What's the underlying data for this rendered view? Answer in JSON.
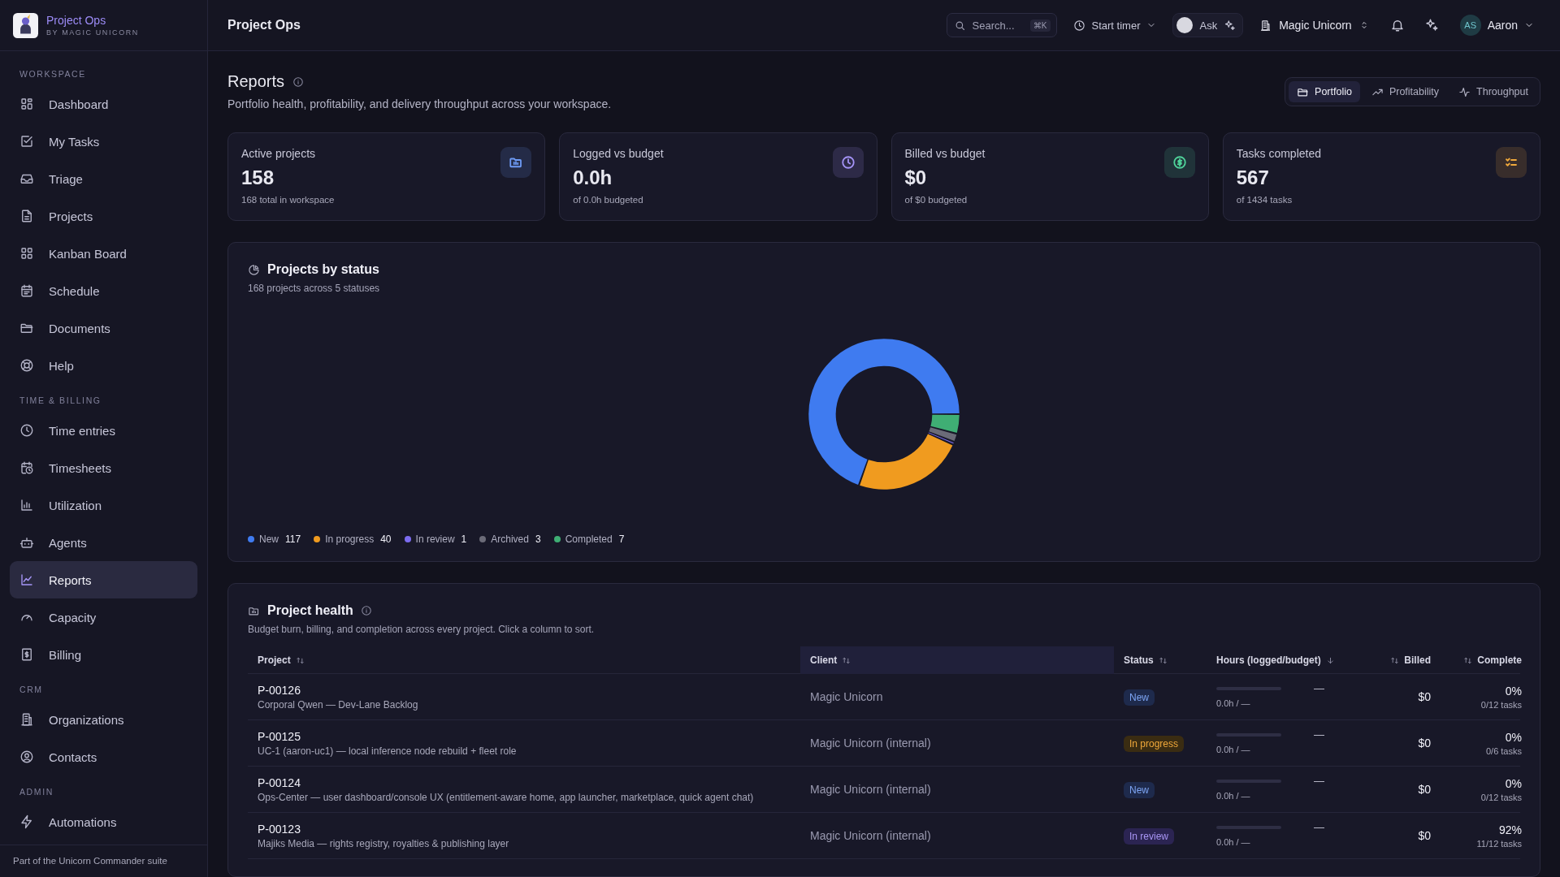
{
  "brand": {
    "name": "Project Ops",
    "tagline": "BY MAGIC UNICORN"
  },
  "sidebar": {
    "sections": [
      {
        "label": "WORKSPACE",
        "items": [
          {
            "label": "Dashboard",
            "selected": false
          },
          {
            "label": "My Tasks",
            "selected": false
          },
          {
            "label": "Triage",
            "selected": false
          },
          {
            "label": "Projects",
            "selected": false
          },
          {
            "label": "Kanban Board",
            "selected": false
          },
          {
            "label": "Schedule",
            "selected": false
          },
          {
            "label": "Documents",
            "selected": false
          },
          {
            "label": "Help",
            "selected": false
          }
        ]
      },
      {
        "label": "TIME & BILLING",
        "items": [
          {
            "label": "Time entries",
            "selected": false
          },
          {
            "label": "Timesheets",
            "selected": false
          },
          {
            "label": "Utilization",
            "selected": false
          },
          {
            "label": "Agents",
            "selected": false
          },
          {
            "label": "Reports",
            "selected": true
          },
          {
            "label": "Capacity",
            "selected": false
          },
          {
            "label": "Billing",
            "selected": false
          }
        ]
      },
      {
        "label": "CRM",
        "items": [
          {
            "label": "Organizations",
            "selected": false
          },
          {
            "label": "Contacts",
            "selected": false
          }
        ]
      },
      {
        "label": "ADMIN",
        "items": [
          {
            "label": "Automations",
            "selected": false
          }
        ]
      }
    ],
    "footer": "Part of the Unicorn Commander suite"
  },
  "header": {
    "title": "Project Ops",
    "search": {
      "placeholder": "Search...",
      "shortcut": "⌘K"
    },
    "timer": "Start timer",
    "ask": "Ask",
    "workspace": "Magic Unicorn",
    "user": {
      "initials": "AS",
      "name": "Aaron"
    }
  },
  "page": {
    "title": "Reports",
    "subtitle": "Portfolio health, profitability, and delivery throughput across your workspace.",
    "tabs": [
      {
        "label": "Portfolio",
        "selected": true
      },
      {
        "label": "Profitability",
        "selected": false
      },
      {
        "label": "Throughput",
        "selected": false
      }
    ]
  },
  "kpis": [
    {
      "label": "Active projects",
      "value": "158",
      "note": "168 total in workspace",
      "color": "#6e9bf5"
    },
    {
      "label": "Logged vs budget",
      "value": "0.0h",
      "note": "of 0.0h budgeted",
      "color": "#a594f7"
    },
    {
      "label": "Billed vs budget",
      "value": "$0",
      "note": "of $0 budgeted",
      "color": "#4fd39a"
    },
    {
      "label": "Tasks completed",
      "value": "567",
      "note": "of 1434 tasks",
      "color": "#f0a93c"
    }
  ],
  "status_chart": {
    "title": "Projects by status",
    "subtitle": "168 projects across 5 statuses",
    "chart_data": {
      "type": "donut",
      "categories": [
        "New",
        "In progress",
        "In review",
        "Archived",
        "Completed"
      ],
      "values": [
        69.6,
        23.8,
        0.6,
        1.8,
        4.2
      ]
    },
    "legend": [
      {
        "count": "117",
        "color": "#3f7bf0"
      },
      {
        "count": "40",
        "color": "#f09b1f"
      },
      {
        "count": "1",
        "color": "#7c6cf0"
      },
      {
        "count": "3",
        "color": "#6b6b78"
      },
      {
        "count": "7",
        "color": "#3fae74"
      }
    ]
  },
  "health": {
    "title": "Project health",
    "subtitle": "Budget burn, billing, and completion across every project. Click a column to sort.",
    "columns": [
      {
        "label": "Project",
        "highlighted": false
      },
      {
        "label": "Client",
        "highlighted": true
      },
      {
        "label": "Status",
        "highlighted": false
      },
      {
        "label": "Hours (logged/budget)",
        "highlighted": false
      },
      {
        "label": "Billed",
        "highlighted": false
      },
      {
        "label": "Complete",
        "highlighted": false
      }
    ],
    "rows": [
      {
        "id": "P-00126",
        "name": "Corporal Qwen — Dev-Lane Backlog",
        "client": "Magic Unicorn",
        "status": {
          "label": "New",
          "kind": "new"
        },
        "level": 0,
        "hours": "0.0h / —",
        "dash": "—",
        "billed": "$0",
        "complete": "0%",
        "tasks": "0/12 tasks"
      },
      {
        "id": "P-00125",
        "name": "UC-1 (aaron-uc1) — local inference node rebuild + fleet role",
        "client": "Magic Unicorn (internal)",
        "status": {
          "label": "In progress",
          "kind": "in_progress"
        },
        "level": 0,
        "hours": "0.0h / —",
        "dash": "—",
        "billed": "$0",
        "complete": "0%",
        "tasks": "0/6 tasks"
      },
      {
        "id": "P-00124",
        "name": "Ops-Center — user dashboard/console UX (entitlement-aware home, app launcher, marketplace, quick agent chat)",
        "client": "Magic Unicorn (internal)",
        "status": {
          "label": "New",
          "kind": "new"
        },
        "level": 0,
        "hours": "0.0h / —",
        "dash": "—",
        "billed": "$0",
        "complete": "0%",
        "tasks": "0/12 tasks"
      },
      {
        "id": "P-00123",
        "name": "Majiks Media — rights registry, royalties & publishing layer",
        "client": "Magic Unicorn (internal)",
        "status": {
          "label": "In review",
          "kind": "in_review"
        },
        "level": 0,
        "hours": "0.0h / —",
        "dash": "—",
        "billed": "$0",
        "complete": "92%",
        "tasks": "11/12 tasks"
      }
    ]
  }
}
